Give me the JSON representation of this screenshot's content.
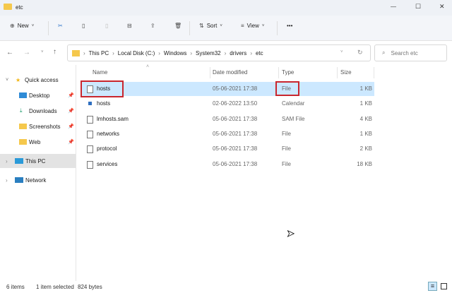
{
  "window": {
    "title": "etc",
    "minimize": "—",
    "maximize": "☐",
    "close": "✕"
  },
  "toolbar": {
    "new": "New",
    "sort": "Sort",
    "view": "View",
    "more": "•••"
  },
  "address": {
    "path": [
      "This PC",
      "Local Disk (C:)",
      "Windows",
      "System32",
      "drivers",
      "etc"
    ],
    "search_placeholder": "Search etc"
  },
  "sidebar": {
    "items": [
      {
        "label": "Quick access"
      },
      {
        "label": "Desktop"
      },
      {
        "label": "Downloads"
      },
      {
        "label": "Screenshots"
      },
      {
        "label": "Web"
      },
      {
        "label": "This PC"
      },
      {
        "label": "Network"
      }
    ]
  },
  "columns": {
    "name": "Name",
    "date": "Date modified",
    "type": "Type",
    "size": "Size"
  },
  "files": [
    {
      "name": "hosts",
      "date": "05-06-2021 17:38",
      "type": "File",
      "size": "1 KB"
    },
    {
      "name": "hosts",
      "date": "02-06-2022 13:50",
      "type": "Calendar",
      "size": "1 KB"
    },
    {
      "name": "lmhosts.sam",
      "date": "05-06-2021 17:38",
      "type": "SAM File",
      "size": "4 KB"
    },
    {
      "name": "networks",
      "date": "05-06-2021 17:38",
      "type": "File",
      "size": "1 KB"
    },
    {
      "name": "protocol",
      "date": "05-06-2021 17:38",
      "type": "File",
      "size": "2 KB"
    },
    {
      "name": "services",
      "date": "05-06-2021 17:38",
      "type": "File",
      "size": "18 KB"
    }
  ],
  "status": {
    "items": "6 items",
    "selected": "1 item selected",
    "size": "824 bytes"
  },
  "colors": {
    "selection": "#cce8ff",
    "highlight": "#c9262e"
  }
}
